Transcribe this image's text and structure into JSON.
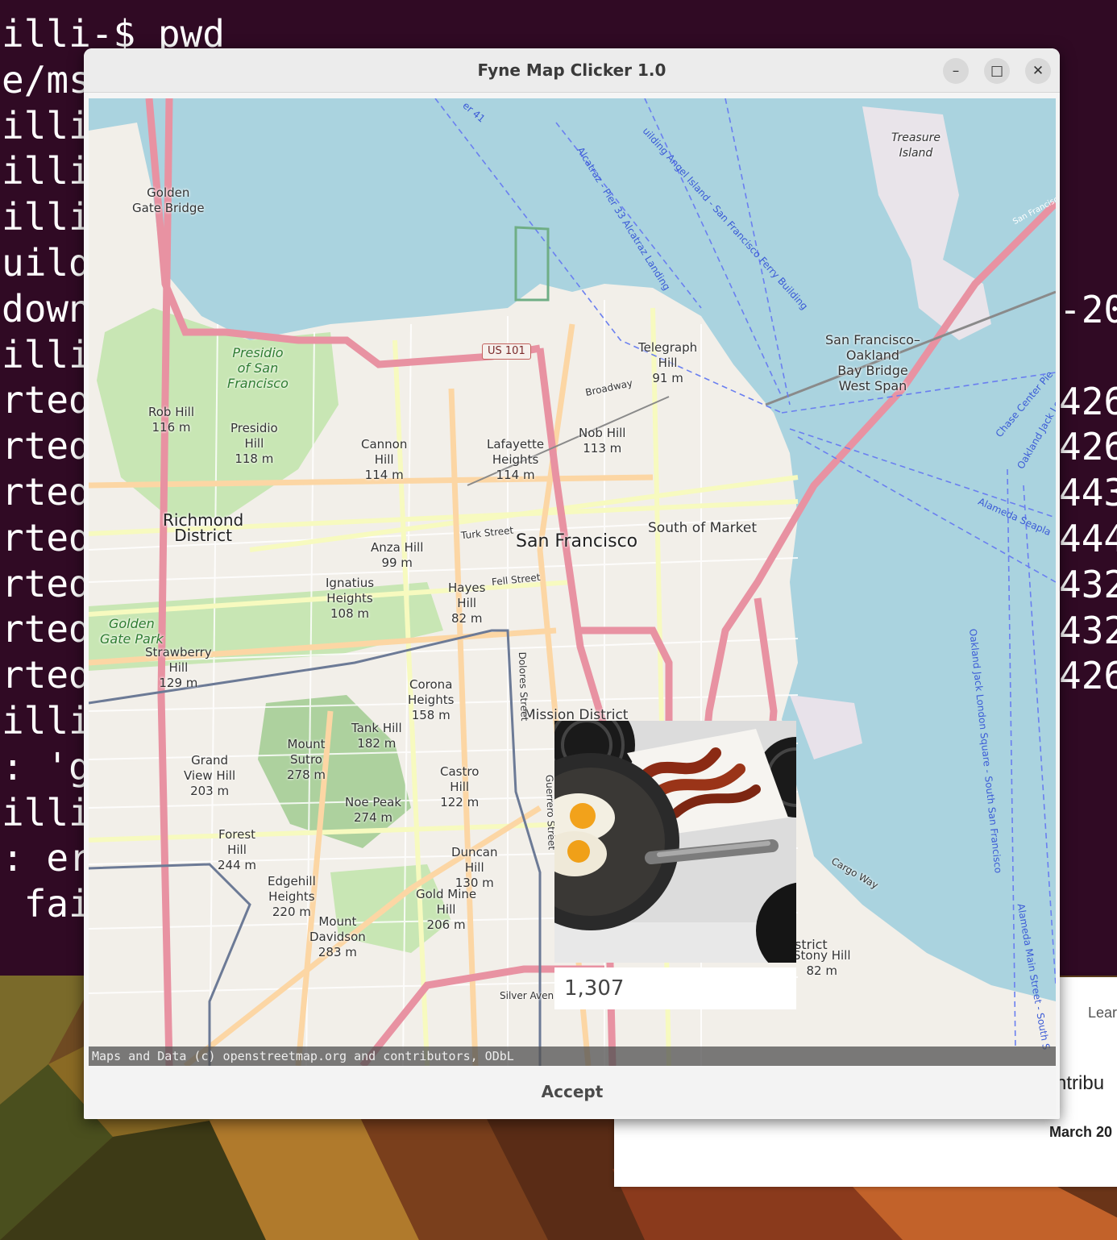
{
  "terminal": {
    "lines": [
      "illi-$ pwd",
      "e/ms",
      "illi",
      "illi",
      "illi",
      "uild",
      "down",
      "illi",
      "rted",
      "rted",
      "rted",
      "rted",
      "rted",
      "rted",
      "rted",
      "illi",
      ": 'g",
      "illi",
      ": er",
      " fai"
    ],
    "right_lines": [
      "-20",
      "426",
      "426",
      "443",
      "444",
      "432",
      "432",
      "426"
    ]
  },
  "background_window": {
    "learn_label": "Lear",
    "contrib_label": "ntribu",
    "date_label": "March 20"
  },
  "window": {
    "title": "Fyne Map Clicker 1.0",
    "minimize_label": "–",
    "maximize_label": "□",
    "close_label": "✕"
  },
  "map": {
    "attribution": "Maps and Data (c) openstreetmap.org and contributors, ODbL",
    "labels": {
      "golden_gate_bridge": "Golden\nGate Bridge",
      "treasure_island": "Treasure\nIsland",
      "presidio": "Presidio\nof San\nFrancisco",
      "rob_hill": "Rob Hill\n116 m",
      "presidio_hill": "Presidio\nHill\n118 m",
      "cannon_hill": "Cannon\nHill\n114 m",
      "lafayette": "Lafayette\nHeights\n114 m",
      "telegraph": "Telegraph\nHill\n91 m",
      "nob_hill": "Nob Hill\n113 m",
      "broadway": "Broadway",
      "us101": "US 101",
      "bay_bridge": "San Francisco–\nOakland\nBay Bridge\nWest Span",
      "richmond": "Richmond\nDistrict",
      "san_francisco": "San Francisco",
      "south_of_market": "South of Market",
      "anza_hill": "Anza Hill\n99 m",
      "turk_street": "Turk Street",
      "fell_street": "Fell Street",
      "ignatius": "Ignatius\nHeights\n108 m",
      "hayes": "Hayes\nHill\n82 m",
      "golden_gate_park": "Golden\nGate Park",
      "strawberry": "Strawberry\nHill\n129 m",
      "corona": "Corona\nHeights\n158 m",
      "mission": "Mission District",
      "tank_hill": "Tank Hill\n182 m",
      "mount_sutro": "Mount\nSutro\n278 m",
      "grand_view": "Grand\nView Hill\n203 m",
      "castro": "Castro\nHill\n122 m",
      "noe_peak": "Noe Peak\n274 m",
      "forest_hill": "Forest\nHill\n244 m",
      "duncan": "Duncan\nHill\n130 m",
      "edgehill": "Edgehill\nHeights\n220 m",
      "gold_mine": "Gold Mine\nHill\n206 m",
      "mount_davidson": "Mount\nDavidson\n283 m",
      "stony_hill": "Stony Hill\n82 m",
      "district": "strict",
      "cargo_way": "Cargo Way",
      "silver_ave": "Silver Avenu",
      "dolores": "Dolores Street",
      "guerrero": "Guerrero Street",
      "alcatraz_ferry": "Alcatraz - Pier 33 Alcatraz Landing",
      "angel_island": "uilding Angel Island - San Francisco Ferry Building",
      "oakland_jack": "Oakland Jack London Square - South San Francisco",
      "alameda_main": "Alameda Main Street - South S",
      "alameda_seaplane": "Alameda Seapla",
      "chase_center": "Chase Center Pie",
      "oakland_jack_lo": "Oakland Jack Lo",
      "ferry41": "er 41",
      "san_francisco_sign": "San Francisc"
    }
  },
  "popup": {
    "coordinate_value": "1,307"
  },
  "accept_label": "Accept",
  "colors": {
    "terminal_bg": "#300a24",
    "water": "#aad3df",
    "land": "#f2efe9",
    "park": "#c8e6b4",
    "motorway": "#e892a2",
    "primary": "#fcd6a4",
    "secondary": "#f7fabf",
    "ferry_line": "#6a7ff0"
  }
}
